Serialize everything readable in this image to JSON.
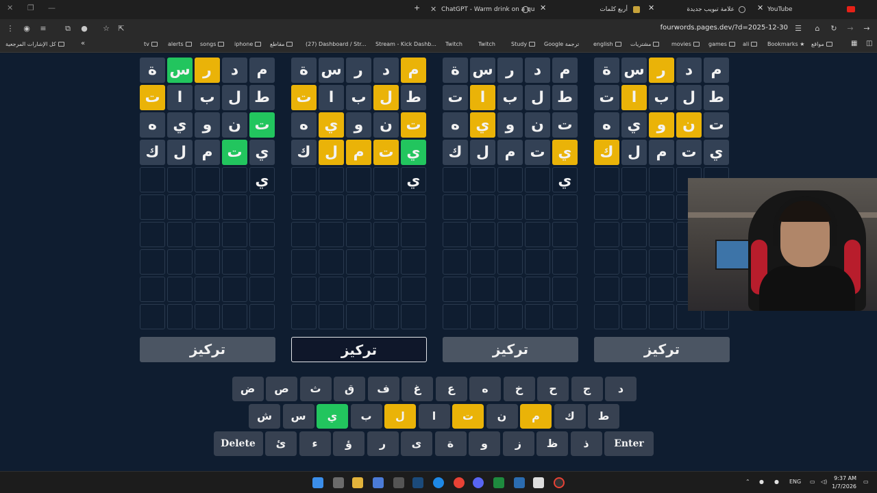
{
  "browser": {
    "tabs": [
      {
        "title": "ChatGPT - Warm drink on a qu"
      },
      {
        "title": "أربع كلمات"
      },
      {
        "title": "علامة تبويب جديدة"
      },
      {
        "title": "YouTube"
      }
    ],
    "url": "fourwords.pages.dev/?d=2025-12-30",
    "bookmarks_left": [
      "كل الإشارات المرجعية"
    ],
    "bookmarks": [
      "tv",
      "alerts",
      "songs",
      "iphone",
      "مقاطع",
      "(27) Dashboard / Str...",
      "Stream - Kick Dashb...",
      "Twitch",
      "Twitch",
      "Study",
      "Google ترجمة",
      "english",
      "مشتريات",
      "movies",
      "games",
      "ali",
      "Bookmarks",
      "مواقع"
    ]
  },
  "game": {
    "boards": [
      {
        "rows": [
          [
            {
              "ch": "ة",
              "s": "b"
            },
            {
              "ch": "س",
              "s": "g"
            },
            {
              "ch": "ر",
              "s": "y"
            },
            {
              "ch": "د",
              "s": "b"
            },
            {
              "ch": "م",
              "s": "b"
            }
          ],
          [
            {
              "ch": "ت",
              "s": "y"
            },
            {
              "ch": "ا",
              "s": "b"
            },
            {
              "ch": "ب",
              "s": "b"
            },
            {
              "ch": "ل",
              "s": "b"
            },
            {
              "ch": "ط",
              "s": "b"
            }
          ],
          [
            {
              "ch": "ه",
              "s": "b"
            },
            {
              "ch": "ي",
              "s": "b"
            },
            {
              "ch": "و",
              "s": "b"
            },
            {
              "ch": "ن",
              "s": "b"
            },
            {
              "ch": "ت",
              "s": "g"
            }
          ],
          [
            {
              "ch": "ك",
              "s": "b"
            },
            {
              "ch": "ل",
              "s": "b"
            },
            {
              "ch": "م",
              "s": "b"
            },
            {
              "ch": "ت",
              "s": "g"
            },
            {
              "ch": "ي",
              "s": "b"
            }
          ],
          [
            {
              "ch": "",
              "s": "e"
            },
            {
              "ch": "",
              "s": "e"
            },
            {
              "ch": "",
              "s": "e"
            },
            {
              "ch": "",
              "s": "e"
            },
            {
              "ch": "ي",
              "s": "e"
            }
          ]
        ],
        "focus_label": "تركيز"
      },
      {
        "rows": [
          [
            {
              "ch": "ة",
              "s": "b"
            },
            {
              "ch": "س",
              "s": "b"
            },
            {
              "ch": "ر",
              "s": "b"
            },
            {
              "ch": "د",
              "s": "b"
            },
            {
              "ch": "م",
              "s": "y"
            }
          ],
          [
            {
              "ch": "ت",
              "s": "y"
            },
            {
              "ch": "ا",
              "s": "b"
            },
            {
              "ch": "ب",
              "s": "b"
            },
            {
              "ch": "ل",
              "s": "y"
            },
            {
              "ch": "ط",
              "s": "b"
            }
          ],
          [
            {
              "ch": "ه",
              "s": "b"
            },
            {
              "ch": "ي",
              "s": "y"
            },
            {
              "ch": "و",
              "s": "b"
            },
            {
              "ch": "ن",
              "s": "b"
            },
            {
              "ch": "ت",
              "s": "y"
            }
          ],
          [
            {
              "ch": "ك",
              "s": "b"
            },
            {
              "ch": "ل",
              "s": "y"
            },
            {
              "ch": "م",
              "s": "y"
            },
            {
              "ch": "ت",
              "s": "y"
            },
            {
              "ch": "ي",
              "s": "g"
            }
          ],
          [
            {
              "ch": "",
              "s": "e"
            },
            {
              "ch": "",
              "s": "e"
            },
            {
              "ch": "",
              "s": "e"
            },
            {
              "ch": "",
              "s": "e"
            },
            {
              "ch": "ي",
              "s": "e"
            }
          ]
        ],
        "focus_label": "تركيز"
      },
      {
        "rows": [
          [
            {
              "ch": "ة",
              "s": "b"
            },
            {
              "ch": "س",
              "s": "b"
            },
            {
              "ch": "ر",
              "s": "b"
            },
            {
              "ch": "د",
              "s": "b"
            },
            {
              "ch": "م",
              "s": "b"
            }
          ],
          [
            {
              "ch": "ت",
              "s": "b"
            },
            {
              "ch": "ا",
              "s": "y"
            },
            {
              "ch": "ب",
              "s": "b"
            },
            {
              "ch": "ل",
              "s": "b"
            },
            {
              "ch": "ط",
              "s": "b"
            }
          ],
          [
            {
              "ch": "ه",
              "s": "b"
            },
            {
              "ch": "ي",
              "s": "y"
            },
            {
              "ch": "و",
              "s": "b"
            },
            {
              "ch": "ن",
              "s": "b"
            },
            {
              "ch": "ت",
              "s": "b"
            }
          ],
          [
            {
              "ch": "ك",
              "s": "b"
            },
            {
              "ch": "ل",
              "s": "b"
            },
            {
              "ch": "م",
              "s": "b"
            },
            {
              "ch": "ت",
              "s": "b"
            },
            {
              "ch": "ي",
              "s": "y"
            }
          ],
          [
            {
              "ch": "",
              "s": "e"
            },
            {
              "ch": "",
              "s": "e"
            },
            {
              "ch": "",
              "s": "e"
            },
            {
              "ch": "",
              "s": "e"
            },
            {
              "ch": "ي",
              "s": "e"
            }
          ]
        ],
        "focus_label": "تركيز"
      },
      {
        "rows": [
          [
            {
              "ch": "ة",
              "s": "b"
            },
            {
              "ch": "س",
              "s": "b"
            },
            {
              "ch": "ر",
              "s": "y"
            },
            {
              "ch": "د",
              "s": "b"
            },
            {
              "ch": "م",
              "s": "b"
            }
          ],
          [
            {
              "ch": "ت",
              "s": "b"
            },
            {
              "ch": "ا",
              "s": "y"
            },
            {
              "ch": "ب",
              "s": "b"
            },
            {
              "ch": "ل",
              "s": "b"
            },
            {
              "ch": "ط",
              "s": "b"
            }
          ],
          [
            {
              "ch": "ه",
              "s": "b"
            },
            {
              "ch": "ي",
              "s": "b"
            },
            {
              "ch": "و",
              "s": "y"
            },
            {
              "ch": "ن",
              "s": "y"
            },
            {
              "ch": "ت",
              "s": "b"
            }
          ],
          [
            {
              "ch": "ك",
              "s": "y"
            },
            {
              "ch": "ل",
              "s": "b"
            },
            {
              "ch": "م",
              "s": "b"
            },
            {
              "ch": "ت",
              "s": "b"
            },
            {
              "ch": "ي",
              "s": "b"
            }
          ],
          [
            {
              "ch": "",
              "s": "e"
            },
            {
              "ch": "",
              "s": "e"
            },
            {
              "ch": "",
              "s": "e"
            },
            {
              "ch": "",
              "s": "e"
            },
            {
              "ch": "",
              "s": "e"
            }
          ]
        ],
        "focus_label": "تركيز"
      }
    ],
    "keyboard": {
      "row1": [
        {
          "k": "ض",
          "s": "n"
        },
        {
          "k": "ص",
          "s": "n"
        },
        {
          "k": "ث",
          "s": "n"
        },
        {
          "k": "ق",
          "s": "n"
        },
        {
          "k": "ف",
          "s": "n"
        },
        {
          "k": "غ",
          "s": "n"
        },
        {
          "k": "ع",
          "s": "n"
        },
        {
          "k": "ه",
          "s": "n"
        },
        {
          "k": "خ",
          "s": "n"
        },
        {
          "k": "ح",
          "s": "n"
        },
        {
          "k": "ج",
          "s": "n"
        },
        {
          "k": "د",
          "s": "n"
        }
      ],
      "row2": [
        {
          "k": "ش",
          "s": "n"
        },
        {
          "k": "س",
          "s": "n"
        },
        {
          "k": "ي",
          "s": "g"
        },
        {
          "k": "ب",
          "s": "n"
        },
        {
          "k": "ل",
          "s": "y"
        },
        {
          "k": "ا",
          "s": "n"
        },
        {
          "k": "ت",
          "s": "y"
        },
        {
          "k": "ن",
          "s": "n"
        },
        {
          "k": "م",
          "s": "y"
        },
        {
          "k": "ك",
          "s": "n"
        },
        {
          "k": "ط",
          "s": "n"
        }
      ],
      "row3": [
        {
          "k": "Delete",
          "s": "n",
          "wide": true
        },
        {
          "k": "ئ",
          "s": "n"
        },
        {
          "k": "ء",
          "s": "n"
        },
        {
          "k": "ؤ",
          "s": "n"
        },
        {
          "k": "ر",
          "s": "n"
        },
        {
          "k": "ى",
          "s": "n"
        },
        {
          "k": "ة",
          "s": "n"
        },
        {
          "k": "و",
          "s": "n"
        },
        {
          "k": "ز",
          "s": "n"
        },
        {
          "k": "ظ",
          "s": "n"
        },
        {
          "k": "ذ",
          "s": "n"
        },
        {
          "k": "Enter",
          "s": "n",
          "wide": true
        }
      ]
    }
  },
  "taskbar": {
    "lang": "ENG",
    "time": "9:37 AM",
    "date": "1/7/2026"
  },
  "colors": {
    "yellow": "#eab308",
    "green": "#22c55e",
    "tile": "#334155",
    "bg": "#0f1d30"
  }
}
